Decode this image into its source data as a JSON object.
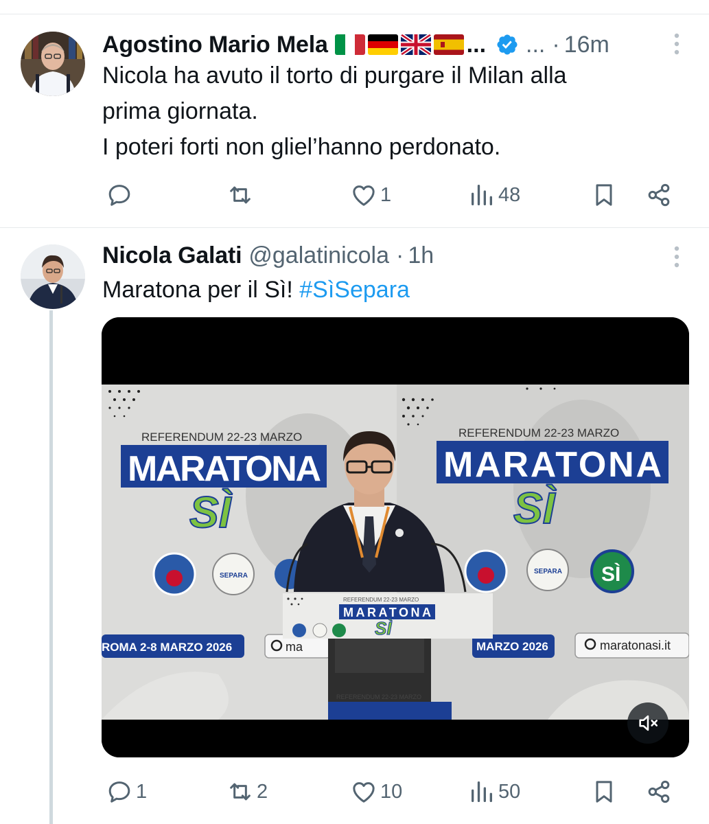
{
  "tweets": [
    {
      "author_name": "Agostino Mario Mela",
      "flags": [
        "flag-italy",
        "flag-germany",
        "flag-uk",
        "flag-spain"
      ],
      "name_ellipsis": "...",
      "verified": true,
      "handle_ellipsis": "...",
      "separator": "·",
      "time": "16m",
      "text_lines": [
        "Nicola ha avuto il torto di purgare il Milan alla",
        "prima giornata.",
        "I poteri forti non gliel’hanno perdonato."
      ],
      "actions": {
        "replies": "",
        "retweets": "",
        "likes": "1",
        "views": "48"
      }
    },
    {
      "author_name": "Nicola Galati",
      "handle": "@galatinicola",
      "separator": "·",
      "time": "1h",
      "text": "Maratona per il Sì! ",
      "hashtag": "#SìSepara",
      "media": {
        "type": "video",
        "scene_text": {
          "referendum": "REFERENDUM 22-23 MARZO",
          "maratona": "MARATONA",
          "si": "SÌ",
          "separa": "SEPARA",
          "roma": "ROMA  2-8 MARZO 2026",
          "marzo": "MARZO 2026",
          "url_left": "ma",
          "url_right": "maratonasi.it"
        },
        "muted": true
      },
      "actions": {
        "replies": "1",
        "retweets": "2",
        "likes": "10",
        "views": "50"
      }
    }
  ],
  "colors": {
    "text": "#0f1419",
    "muted": "#536471",
    "link": "#1d9bf0",
    "divider": "#e6e9ec",
    "thread_line": "#cfd9de",
    "maratona_blue": "#1c3f94",
    "si_green": "#7dc242"
  }
}
